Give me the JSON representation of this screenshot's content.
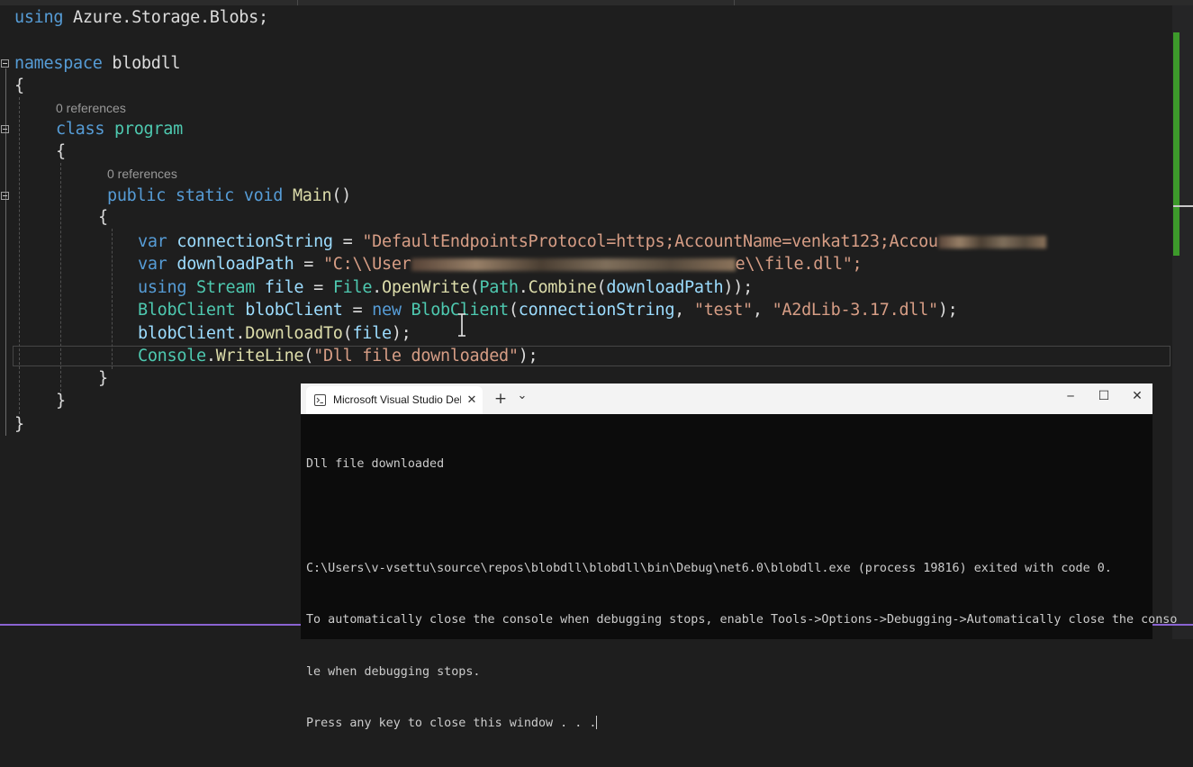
{
  "code": {
    "line_using": [
      "using",
      "Azure.Storage.Blobs;"
    ],
    "ns_kw": "namespace",
    "ns_name": "blobdll",
    "brace_open": "{",
    "brace_close": "}",
    "refs_label": "0 references",
    "class_kw": "class",
    "class_name": "program",
    "main_kw": [
      "public",
      "static",
      "void"
    ],
    "main_name": "Main",
    "main_parens": "()",
    "var_kw": "var",
    "conn_var": "connectionString",
    "eq": "=",
    "conn_str_visible": "\"DefaultEndpointsProtocol=https;AccountName=venkat123;Accou",
    "dl_var": "downloadPath",
    "dl_str_start": "\"C:\\\\User",
    "dl_str_end": "e\\\\file.dll\";",
    "using_kw": "using",
    "stream_type": "Stream",
    "file_var": "file",
    "file_type": "File",
    "open_write": "OpenWrite",
    "path_type": "Path",
    "combine": "Combine",
    "dl_arg": "downloadPath",
    "close_parens": "));",
    "blob_type": "BlobClient",
    "blob_var": "blobClient",
    "new_kw": "new",
    "conn_arg": "connectionString",
    "test_str": "\"test\"",
    "dll_str": "\"A2dLib-3.17.dll\"",
    "end_call": ");",
    "download_to": "DownloadTo",
    "console_type": "Console",
    "write_line": "WriteLine",
    "msg_str": "\"Dll file downloaded\""
  },
  "console": {
    "tab_title": "Microsoft Visual Studio Debug Console",
    "tab_close": "✕",
    "new_tab": "+",
    "dropdown": "⌄",
    "minimize": "─",
    "maximize": "☐",
    "close": "✕",
    "lines": [
      "Dll file downloaded",
      "",
      "C:\\Users\\v-vsettu\\source\\repos\\blobdll\\blobdll\\bin\\Debug\\net6.0\\blobdll.exe (process 19816) exited with code 0.",
      "To automatically close the console when debugging stops, enable Tools->Options->Debugging->Automatically close the conso",
      "le when debugging stops.",
      "Press any key to close this window . . ."
    ]
  },
  "colors": {
    "editor_bg": "#1e1e1e",
    "keyword": "#569cd6",
    "type": "#4ec9b0",
    "method": "#dcdcaa",
    "identifier": "#9cdcfe",
    "string": "#d69d85",
    "scrollbar_change": "#3d9a2b",
    "status_accent": "#8a63d2"
  }
}
